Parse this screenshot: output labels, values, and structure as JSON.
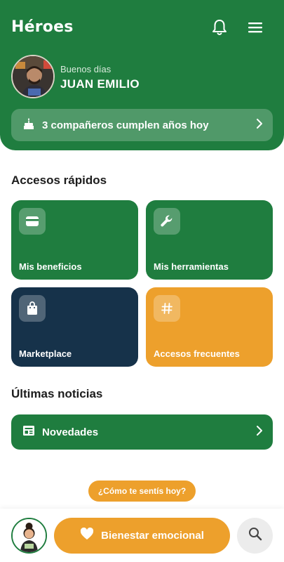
{
  "app": {
    "title": "Héroes"
  },
  "header": {
    "greeting": "Buenos días",
    "user_name": "JUAN EMILIO"
  },
  "birthday_banner": {
    "text": "3 compañeros cumplen años hoy",
    "icon": "cake-icon"
  },
  "quick_access": {
    "title": "Accesos rápidos",
    "tiles": [
      {
        "label": "Mis beneficios",
        "icon": "wallet-icon",
        "color": "#1f7d3f"
      },
      {
        "label": "Mis herramientas",
        "icon": "wrench-icon",
        "color": "#1f7d3f"
      },
      {
        "label": "Marketplace",
        "icon": "shopping-bag-icon",
        "color": "#16324a"
      },
      {
        "label": "Accesos frecuentes",
        "icon": "hashtag-icon",
        "color": "#eda02c"
      }
    ]
  },
  "news": {
    "title": "Últimas noticias",
    "item_label": "Novedades",
    "icon": "newspaper-icon"
  },
  "mood_prompt": {
    "text": "¿Cómo te sentís hoy?"
  },
  "bottom_bar": {
    "wellbeing_label": "Bienestar emocional",
    "icons": [
      "assistant-avatar",
      "heart-icon",
      "search-icon"
    ]
  },
  "colors": {
    "primary_green": "#1f7d3f",
    "navy": "#16324a",
    "orange": "#eda02c"
  }
}
